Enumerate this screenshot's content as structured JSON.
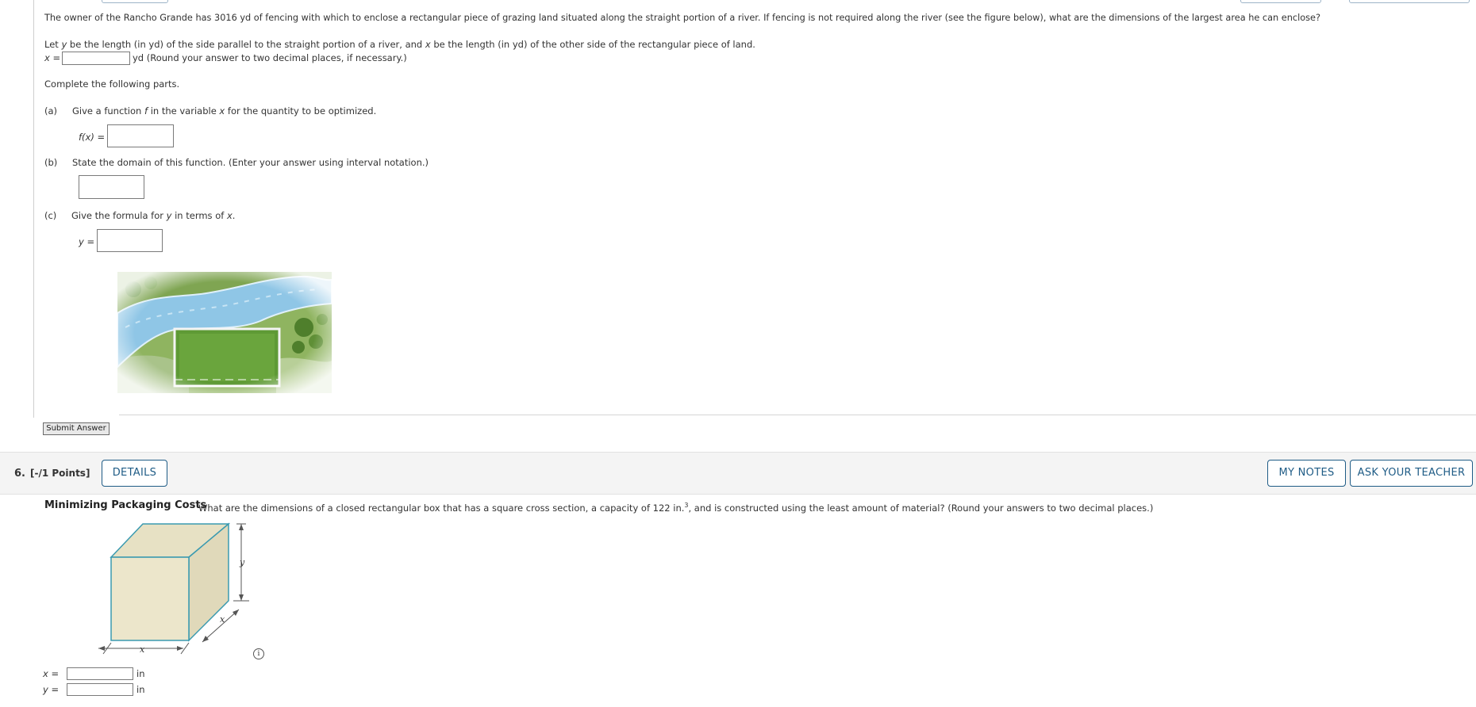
{
  "q5": {
    "problem": "The owner of the Rancho Grande has 3016 yd of fencing with which to enclose a rectangular piece of grazing land situated along the straight portion of a river. If fencing is not required along the river (see the figure below), what are the dimensions of the largest area he can enclose?",
    "let_pre": "Let ",
    "let_y": "y",
    "let_mid1": " be the length (in yd) of the side parallel to the straight portion of a river, and ",
    "let_x": "x",
    "let_mid2": " be the length (in yd) of the other side of the rectangular piece of land.",
    "x_label": "x =",
    "x_unit": "yd (Round your answer to two decimal places, if necessary.)",
    "complete": "Complete the following parts.",
    "part_a_label": "(a)",
    "part_a_pre": "Give a function ",
    "part_a_f": "f",
    "part_a_mid": " in the variable ",
    "part_a_x": "x",
    "part_a_post": " for the quantity to be optimized.",
    "fx_label": "f(x) =",
    "part_b_label": "(b)",
    "part_b_text": "State the domain of this function. (Enter your answer using interval notation.)",
    "part_c_label": "(c)",
    "part_c_pre": "Give the formula for ",
    "part_c_y": "y",
    "part_c_mid": " in terms of ",
    "part_c_x": "x",
    "part_c_post": ".",
    "y_label": "y =",
    "submit": "Submit Answer"
  },
  "q6": {
    "number": "6.",
    "points": "[-/1 Points]",
    "details": "DETAILS",
    "my_notes": "MY NOTES",
    "ask_teacher": "ASK YOUR TEACHER",
    "title": "Minimizing Packaging Costs",
    "problem_pre": "What are the dimensions of a closed rectangular box that has a square cross section, a capacity of 122 in.",
    "problem_sup": "3",
    "problem_post": ", and is constructed using the least amount of material? (Round your answers to two decimal places.)",
    "fig_label_y": "y",
    "fig_label_x1": "x",
    "fig_label_x2": "x",
    "info": "i",
    "x_label": "x =",
    "y_label": "y =",
    "unit_x": "in",
    "unit_y": "in"
  },
  "colors": {
    "accent": "#1f5c86",
    "river": "#8fc6e6",
    "grass": "#5f9a3a",
    "box_face": "#e7e1c4",
    "box_edge": "#3a9ab0"
  }
}
